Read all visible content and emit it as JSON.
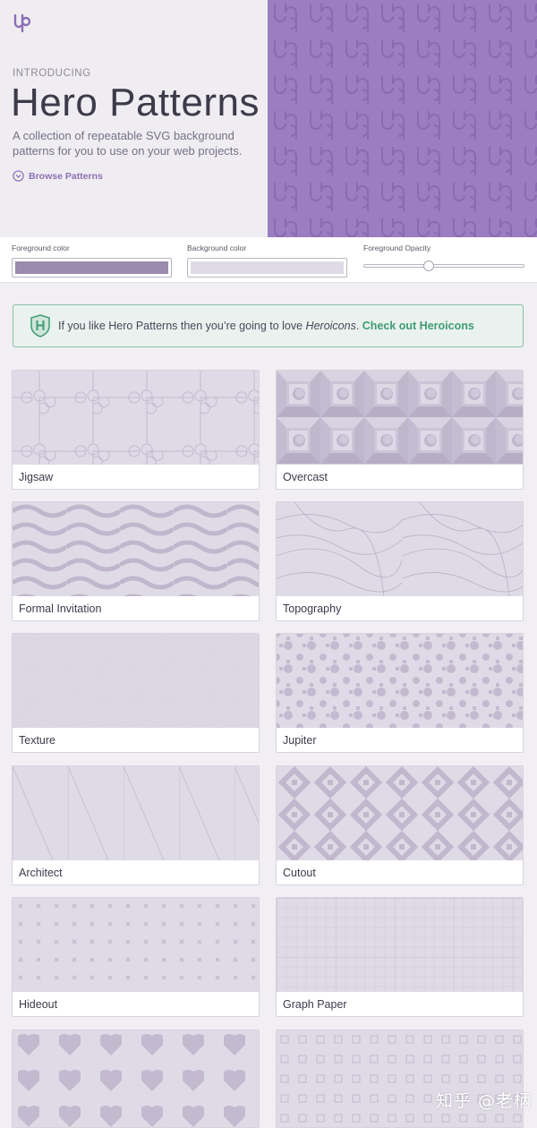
{
  "hero": {
    "introducing": "INTRODUCING",
    "title": "Hero Patterns",
    "description": "A collection of repeatable SVG background patterns for you to use on your web projects.",
    "browse_label": "Browse Patterns"
  },
  "controls": {
    "foreground_label": "Foreground color",
    "background_label": "Background color",
    "opacity_label": "Foreground Opacity",
    "foreground_color": "#9b8bad",
    "background_color": "#dfdbe6",
    "opacity_value": 0.4
  },
  "banner": {
    "text_before": "If you like Hero Patterns then you’re going to love ",
    "emphasis": "Heroicons",
    "text_after": ". ",
    "link": "Check out Heroicons"
  },
  "patterns": [
    {
      "name": "Jigsaw"
    },
    {
      "name": "Overcast"
    },
    {
      "name": "Formal Invitation"
    },
    {
      "name": "Topography"
    },
    {
      "name": "Texture"
    },
    {
      "name": "Jupiter"
    },
    {
      "name": "Architect"
    },
    {
      "name": "Cutout"
    },
    {
      "name": "Hideout"
    },
    {
      "name": "Graph Paper"
    }
  ],
  "watermark": "知乎 @老柄",
  "colors": {
    "accent": "#8c6fb4",
    "hero_pattern": "#9b7dc1",
    "card_pattern_bg": "#dfdbe6",
    "card_pattern_fg": "#bdb4c9",
    "banner_border": "#86c2a6",
    "banner_link": "#3f9b73"
  }
}
